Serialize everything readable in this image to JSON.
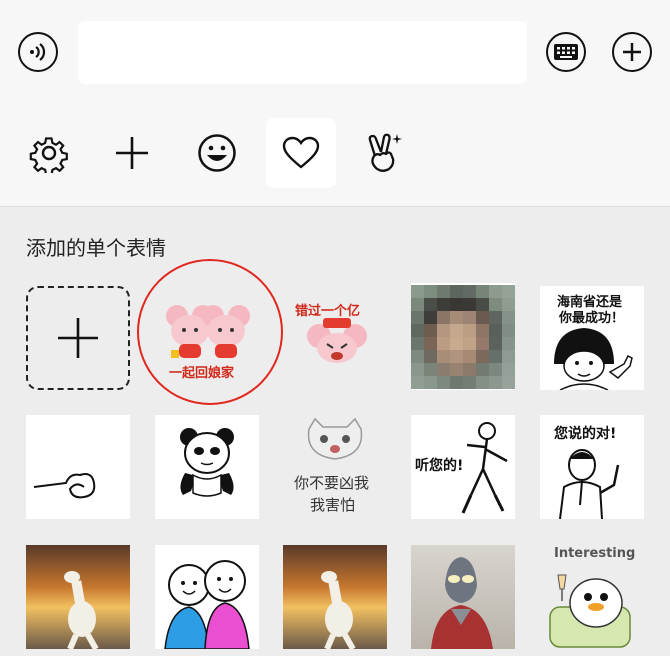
{
  "input_bar": {
    "text_value": "",
    "voice_icon": "voice-icon",
    "keyboard_icon": "keyboard-icon",
    "add_icon": "plus-circle-icon"
  },
  "tabs": [
    {
      "icon": "gear-icon",
      "name": "settings"
    },
    {
      "icon": "plus-icon",
      "name": "add"
    },
    {
      "icon": "smiley-icon",
      "name": "emoji"
    },
    {
      "icon": "heart-icon",
      "name": "favorites",
      "active": true
    },
    {
      "icon": "victory-hand-icon",
      "name": "gesture"
    }
  ],
  "section": {
    "title": "添加的单个表情"
  },
  "stickers": {
    "mice_caption": "一起回娘家",
    "mouse_cry_caption": "错过一个亿",
    "mushroom_caption_line1": "海南省还是",
    "mushroom_caption_line2": "你最成功！",
    "cat_caption_line1": "你不要凶我",
    "cat_caption_line2": "我害怕",
    "listen_caption": "听您的!",
    "agree_caption": "您说的对!",
    "duck_caption": "Interesting"
  },
  "colors": {
    "highlight_ring": "#e0281f",
    "active_tab_bg": "#ffffff",
    "panel_bg": "#ededed",
    "top_bg": "#f7f7f7"
  }
}
